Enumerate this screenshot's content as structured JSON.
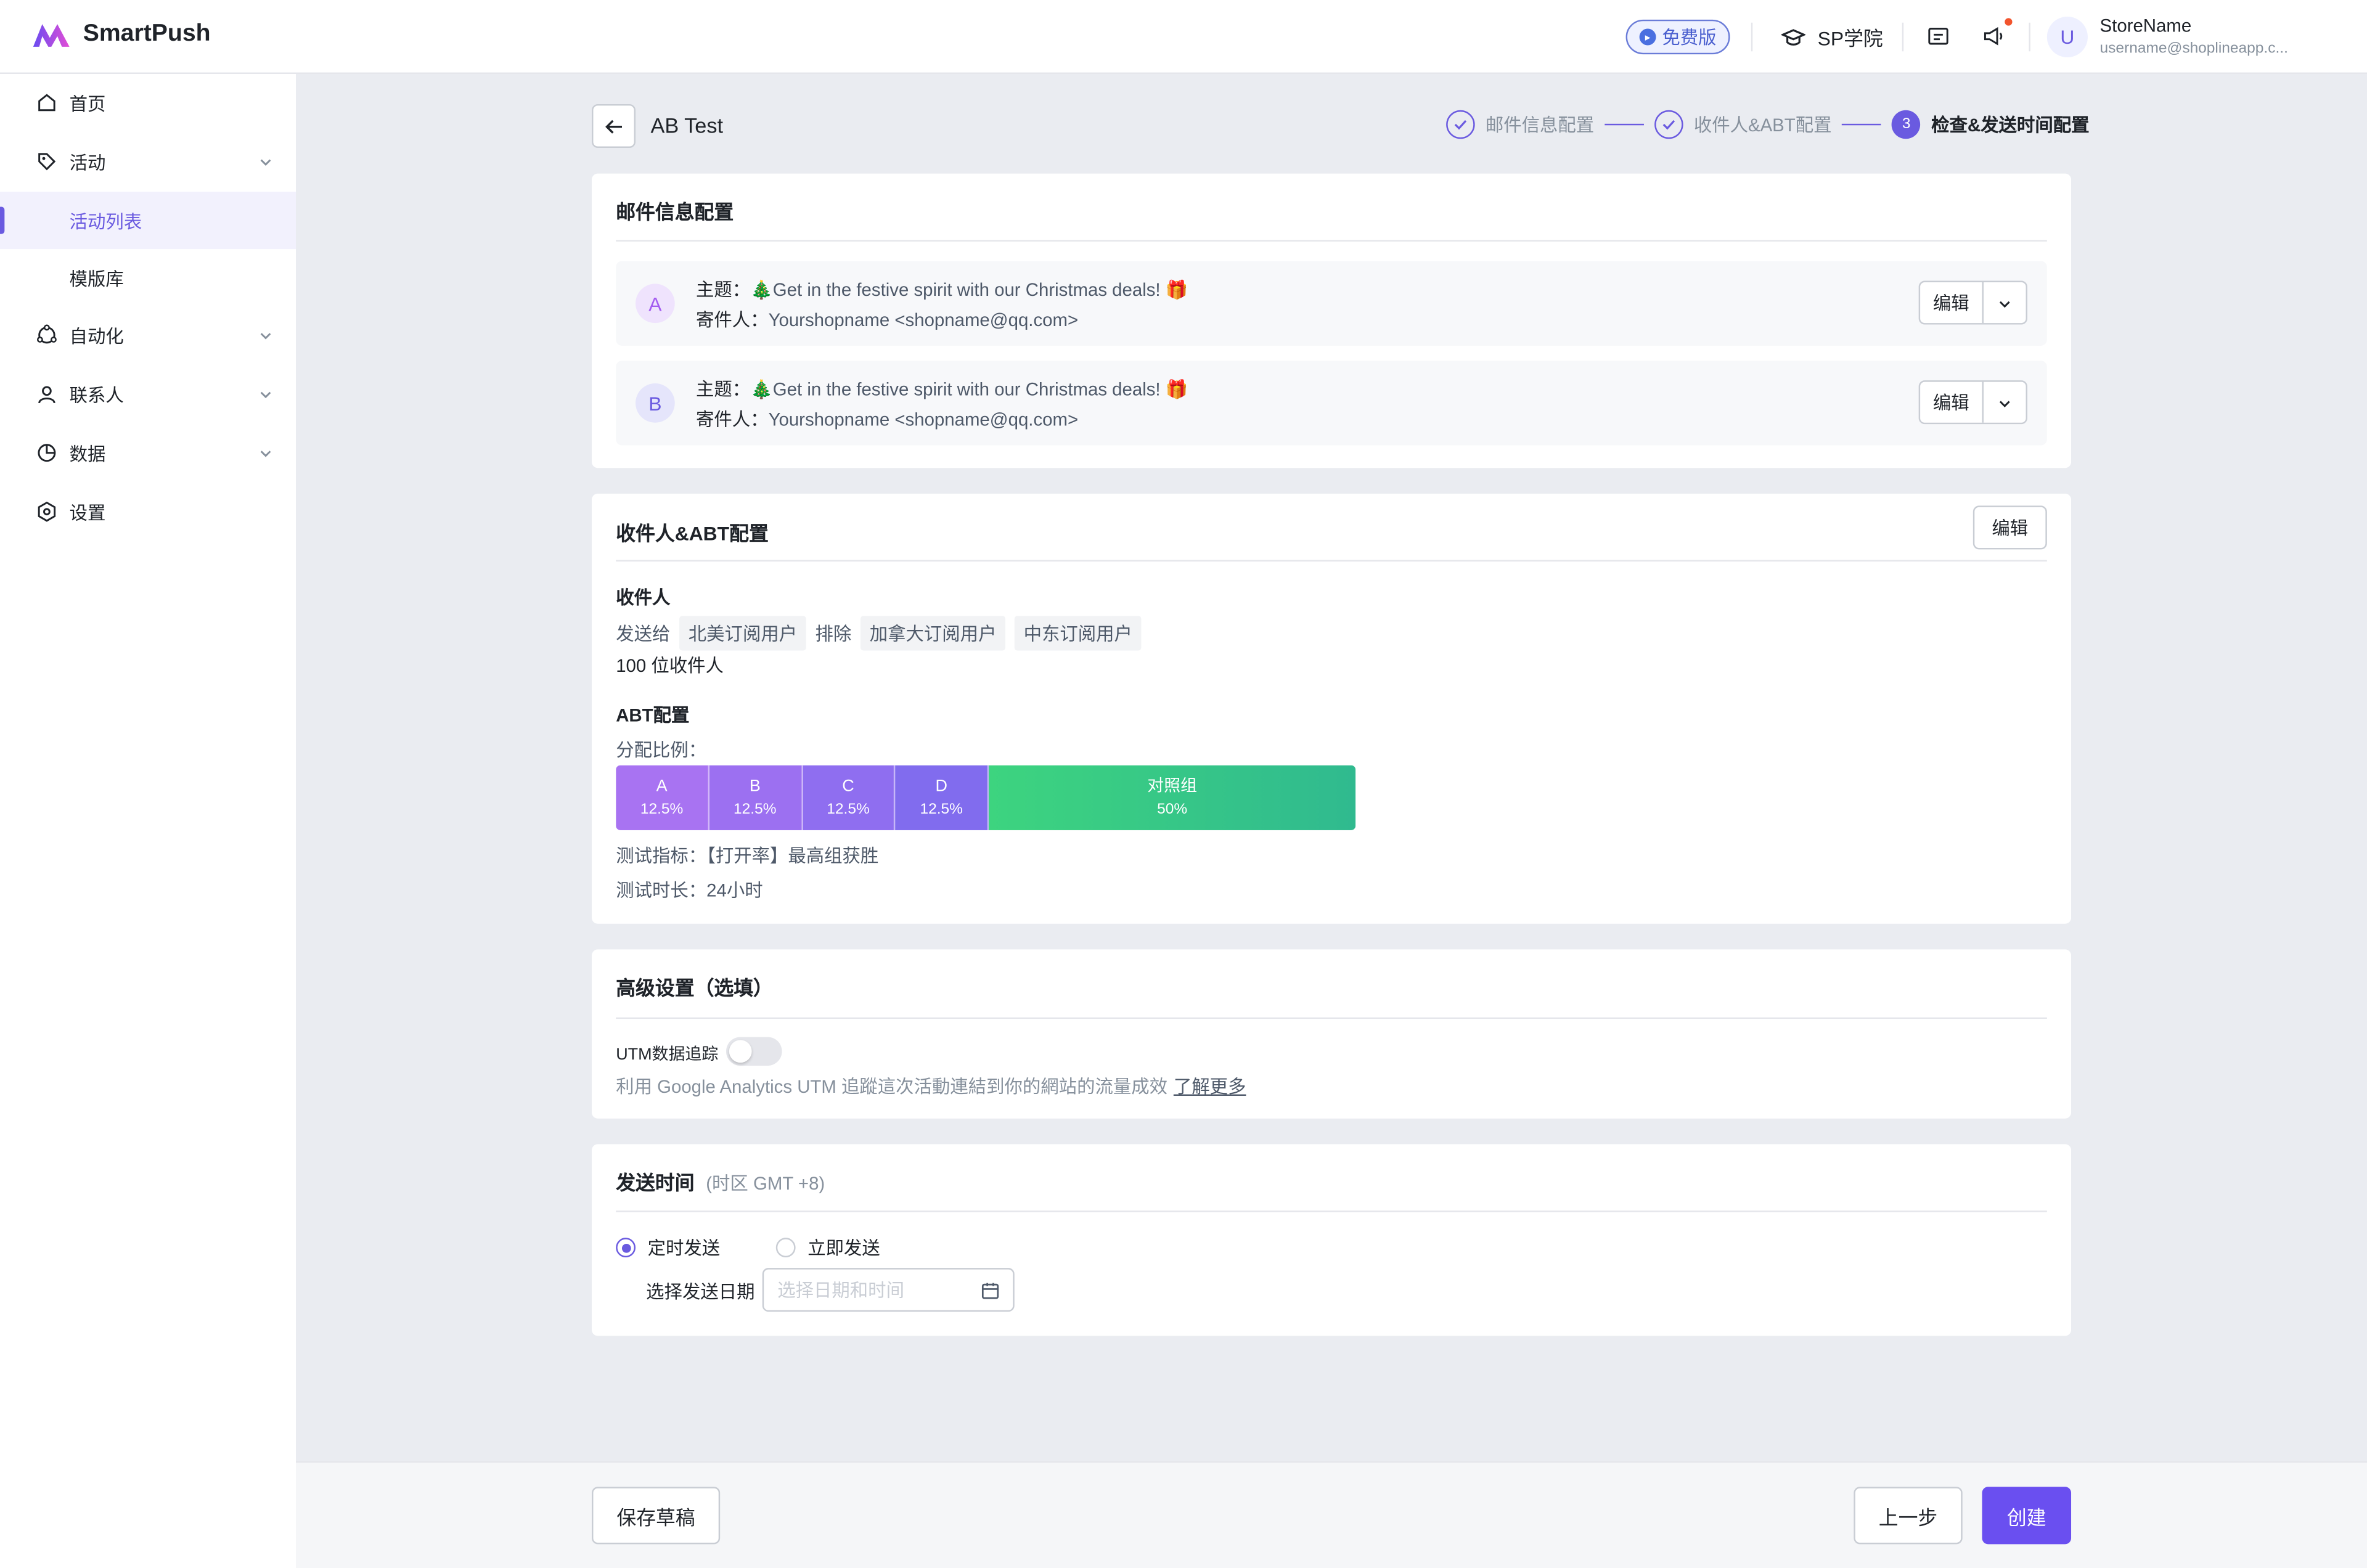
{
  "app": {
    "name": "SmartPush",
    "plan_badge": "免费版",
    "academy": "SP学院"
  },
  "user": {
    "avatar_initial": "U",
    "store_name": "StoreName",
    "email": "username@shoplineapp.c..."
  },
  "sidebar": {
    "items": [
      {
        "label": "首页",
        "icon": "home-icon"
      },
      {
        "label": "活动",
        "icon": "tag-icon",
        "expandable": true
      },
      {
        "label": "活动列表",
        "active": true
      },
      {
        "label": "模版库"
      },
      {
        "label": "自动化",
        "icon": "automation-icon",
        "expandable": true
      },
      {
        "label": "联系人",
        "icon": "user-icon",
        "expandable": true
      },
      {
        "label": "数据",
        "icon": "pie-chart-icon",
        "expandable": true
      },
      {
        "label": "设置",
        "icon": "settings-icon"
      }
    ]
  },
  "page": {
    "title": "AB Test"
  },
  "steps": [
    {
      "num": "",
      "label": "邮件信息配置",
      "status": "done"
    },
    {
      "num": "",
      "label": "收件人&ABT配置",
      "status": "done"
    },
    {
      "num": "3",
      "label": "检查&发送时间配置",
      "status": "active"
    }
  ],
  "mail_section": {
    "title": "邮件信息配置",
    "subject_key": "主题：",
    "sender_key": "寄件人：",
    "edit_label": "编辑",
    "variants": [
      {
        "badge": "A",
        "subject": "🎄Get in the festive spirit with our Christmas deals! 🎁",
        "sender": "Yourshopname <shopname@qq.com>"
      },
      {
        "badge": "B",
        "subject": "🎄Get in the festive spirit with our Christmas deals! 🎁",
        "sender": "Yourshopname <shopname@qq.com>"
      }
    ]
  },
  "recipients_section": {
    "title": "收件人&ABT配置",
    "edit_label": "编辑",
    "recipients_label": "收件人",
    "send_to_label": "发送给",
    "include_tag": "北美订阅用户",
    "exclude_label": "排除",
    "exclude_tags": [
      "加拿大订阅用户",
      "中东订阅用户"
    ],
    "count_text": "100 位收件人",
    "abt_label": "ABT配置",
    "ratio_label": "分配比例：",
    "segments": [
      {
        "name": "A",
        "percent": "12.5%",
        "value": 12.5,
        "color": "#a873f2"
      },
      {
        "name": "B",
        "percent": "12.5%",
        "value": 12.5,
        "color": "#9b6ff0"
      },
      {
        "name": "C",
        "percent": "12.5%",
        "value": 12.5,
        "color": "#8f6ef0"
      },
      {
        "name": "D",
        "percent": "12.5%",
        "value": 12.5,
        "color": "#7f6cee"
      },
      {
        "name": "对照组",
        "percent": "50%",
        "value": 50,
        "color": "#3ccf85"
      }
    ],
    "metric_text": "测试指标：【打开率】最高组获胜",
    "duration_text": "测试时长：24小时"
  },
  "advanced_section": {
    "title": "高级设置（选填）",
    "utm_label": "UTM数据追踪",
    "utm_enabled": false,
    "utm_desc": "利用 Google Analytics UTM 追蹤這次活動連結到你的網站的流量成效",
    "learn_more": "了解更多"
  },
  "send_section": {
    "title": "发送时间",
    "timezone": "(时区   GMT +8)",
    "scheduled_label": "定时发送",
    "immediate_label": "立即发送",
    "selected": "scheduled",
    "date_label": "选择发送日期",
    "date_placeholder": "选择日期和时间"
  },
  "footer": {
    "save_draft": "保存草稿",
    "prev": "上一步",
    "create": "创建"
  },
  "colors": {
    "accent": "#6a5ae0",
    "green_start": "#3ccf85",
    "green_end": "#2fb98c"
  }
}
